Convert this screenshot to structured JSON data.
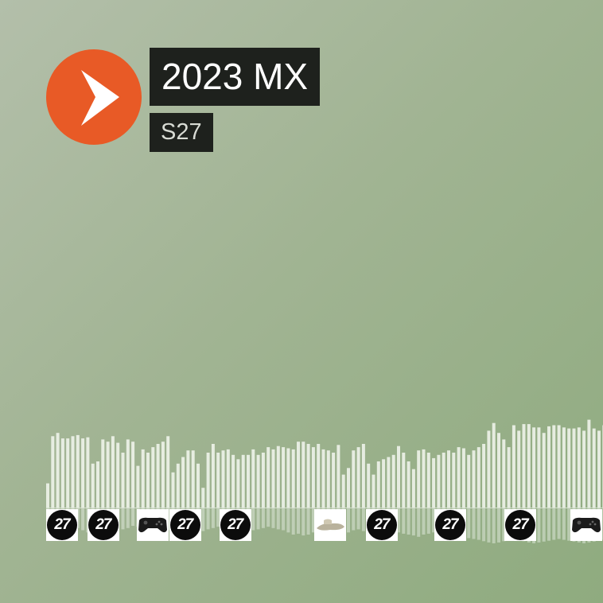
{
  "track": {
    "title": "2023 MX",
    "artist": "S27"
  },
  "player": {
    "button_icon": "play-icon",
    "accent_color": "#e85a26"
  },
  "waveform": {
    "upper_levels": [
      0.22,
      0.65,
      0.68,
      0.63,
      0.63,
      0.65,
      0.66,
      0.63,
      0.64,
      0.4,
      0.42,
      0.62,
      0.6,
      0.65,
      0.59,
      0.5,
      0.62,
      0.6,
      0.38,
      0.53,
      0.5,
      0.55,
      0.58,
      0.6,
      0.65,
      0.32,
      0.4,
      0.46,
      0.52,
      0.52,
      0.4,
      0.18,
      0.5,
      0.58,
      0.5,
      0.52,
      0.53,
      0.48,
      0.44,
      0.48,
      0.48,
      0.53,
      0.48,
      0.5,
      0.55,
      0.53,
      0.56,
      0.55,
      0.54,
      0.53,
      0.6,
      0.6,
      0.58,
      0.55,
      0.58,
      0.53,
      0.52,
      0.5,
      0.57,
      0.3,
      0.36,
      0.52,
      0.55,
      0.58,
      0.4,
      0.3,
      0.42,
      0.44,
      0.46,
      0.48,
      0.56,
      0.5,
      0.42,
      0.35,
      0.52,
      0.53,
      0.5,
      0.45,
      0.48,
      0.5,
      0.52,
      0.5,
      0.55,
      0.54,
      0.48,
      0.52,
      0.55,
      0.58,
      0.7,
      0.77,
      0.68,
      0.62,
      0.55,
      0.75,
      0.7,
      0.76,
      0.76,
      0.73,
      0.73,
      0.68,
      0.74,
      0.75,
      0.75,
      0.73,
      0.72,
      0.72,
      0.73,
      0.7,
      0.8,
      0.72,
      0.7,
      0.75
    ],
    "lower_levels": [
      0.4,
      0.45,
      0.5,
      0.55,
      0.52,
      0.48,
      0.45,
      0.5,
      0.55,
      0.52,
      0.5,
      0.48,
      0.52,
      0.55,
      0.5,
      0.48,
      0.45,
      0.4,
      0.42,
      0.45,
      0.48,
      0.5,
      0.52,
      0.55,
      0.5,
      0.45,
      0.4,
      0.42,
      0.45,
      0.48,
      0.5,
      0.52,
      0.48,
      0.45,
      0.42,
      0.4,
      0.45,
      0.5,
      0.48,
      0.52,
      0.55,
      0.5,
      0.48,
      0.45,
      0.42,
      0.45,
      0.48,
      0.5,
      0.55,
      0.6,
      0.58,
      0.62,
      0.6,
      0.55,
      0.58,
      0.55,
      0.52,
      0.5,
      0.55,
      0.58,
      0.55,
      0.5,
      0.48,
      0.52,
      0.5,
      0.48,
      0.45,
      0.48,
      0.5,
      0.52,
      0.55,
      0.58,
      0.6,
      0.62,
      0.65,
      0.6,
      0.58,
      0.55,
      0.52,
      0.55,
      0.58,
      0.6,
      0.62,
      0.65,
      0.68,
      0.7,
      0.72,
      0.75,
      0.78,
      0.8,
      0.78,
      0.75,
      0.72,
      0.7,
      0.72,
      0.75,
      0.78,
      0.8,
      0.78,
      0.76,
      0.74,
      0.72,
      0.7,
      0.72,
      0.74,
      0.76,
      0.78,
      0.8,
      0.78,
      0.76,
      0.74,
      0.72
    ],
    "bar_color": "#eef3ea"
  },
  "comments": [
    {
      "type": "logo",
      "badge": "27",
      "at": 0.0
    },
    {
      "type": "logo",
      "badge": "27",
      "at": 0.074
    },
    {
      "type": "gamepad",
      "at": 0.163
    },
    {
      "type": "logo",
      "badge": "27",
      "at": 0.221
    },
    {
      "type": "logo",
      "badge": "27",
      "at": 0.311
    },
    {
      "type": "slipper",
      "at": 0.481
    },
    {
      "type": "logo",
      "badge": "27",
      "at": 0.574
    },
    {
      "type": "logo",
      "badge": "27",
      "at": 0.697
    },
    {
      "type": "logo",
      "badge": "27",
      "at": 0.823
    },
    {
      "type": "gamepad",
      "at": 0.941
    }
  ]
}
